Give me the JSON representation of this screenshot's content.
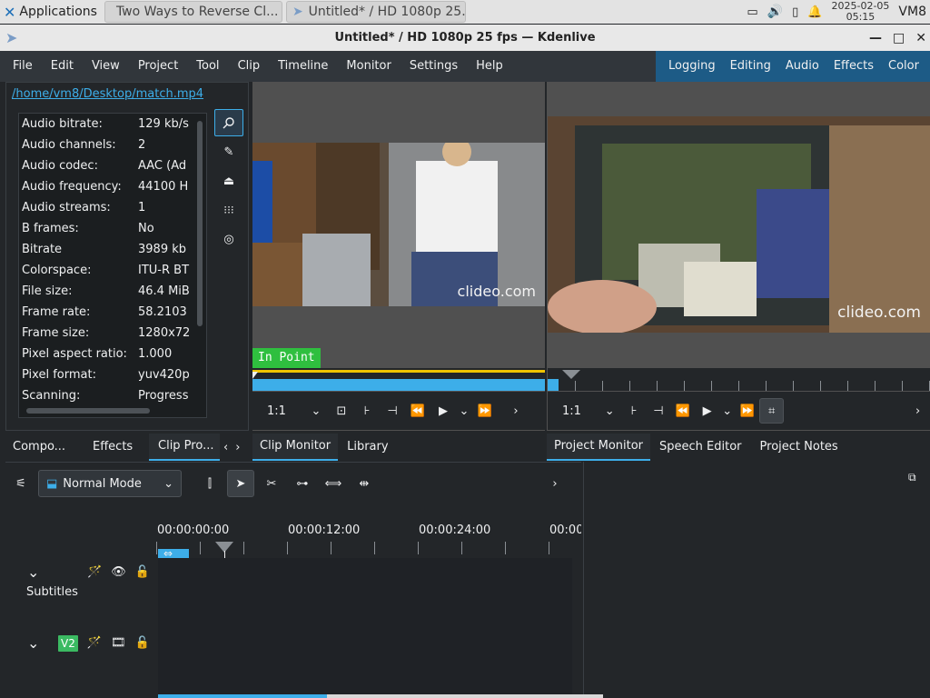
{
  "taskbar": {
    "applications_label": "Applications",
    "tasks": [
      {
        "label": "Two Ways to Reverse Cl..."
      },
      {
        "label": "Untitled* / HD 1080p 25..."
      }
    ],
    "clock_date": "2025-02-05",
    "clock_time": "05:15",
    "user": "VM8"
  },
  "window": {
    "title": "Untitled* / HD 1080p 25 fps — Kdenlive"
  },
  "menu": [
    "File",
    "Edit",
    "View",
    "Project",
    "Tool",
    "Clip",
    "Timeline",
    "Monitor",
    "Settings",
    "Help"
  ],
  "layouts": [
    "Logging",
    "Editing",
    "Audio",
    "Effects",
    "Color"
  ],
  "clip_properties": {
    "path": "/home/vm8/Desktop/match.mp4",
    "rows": [
      {
        "k": "Audio bitrate:",
        "v": "129 kb/s"
      },
      {
        "k": "Audio channels:",
        "v": "2"
      },
      {
        "k": "Audio codec:",
        "v": "AAC (Ad"
      },
      {
        "k": "Audio frequency:",
        "v": "44100 H"
      },
      {
        "k": "Audio streams:",
        "v": "1"
      },
      {
        "k": "B frames:",
        "v": "No"
      },
      {
        "k": "Bitrate",
        "v": "3989 kb"
      },
      {
        "k": "Colorspace:",
        "v": "ITU-R BT"
      },
      {
        "k": "File size:",
        "v": "46.4 MiB"
      },
      {
        "k": "Frame rate:",
        "v": "58.2103"
      },
      {
        "k": "Frame size:",
        "v": "1280x72"
      },
      {
        "k": "Pixel aspect ratio:",
        "v": "1.000"
      },
      {
        "k": "Pixel format:",
        "v": "yuv420p"
      },
      {
        "k": "Scanning:",
        "v": "Progress"
      }
    ]
  },
  "clip_monitor": {
    "watermark": "clideo.com",
    "in_point_label": "In Point",
    "zoom": "1:1"
  },
  "project_monitor": {
    "watermark": "clideo.com",
    "zoom": "1:1"
  },
  "left_tabs": [
    "Compo...",
    "Effects",
    "Clip Pro..."
  ],
  "monitor_tabs": [
    "Clip Monitor",
    "Library"
  ],
  "project_tabs": [
    "Project Monitor",
    "Speech Editor",
    "Project Notes"
  ],
  "timeline": {
    "mode": "Normal Mode",
    "ruler": [
      "00:00:00:00",
      "00:00:12:00",
      "00:00:24:00",
      "00:00"
    ],
    "subtitles_label": "Subtitles",
    "v2_label": "V2"
  },
  "colors": {
    "accent": "#3daee9",
    "layout_bar": "#1d5b86",
    "in_point": "#2fbf3f",
    "track_badge": "#3bba62"
  }
}
